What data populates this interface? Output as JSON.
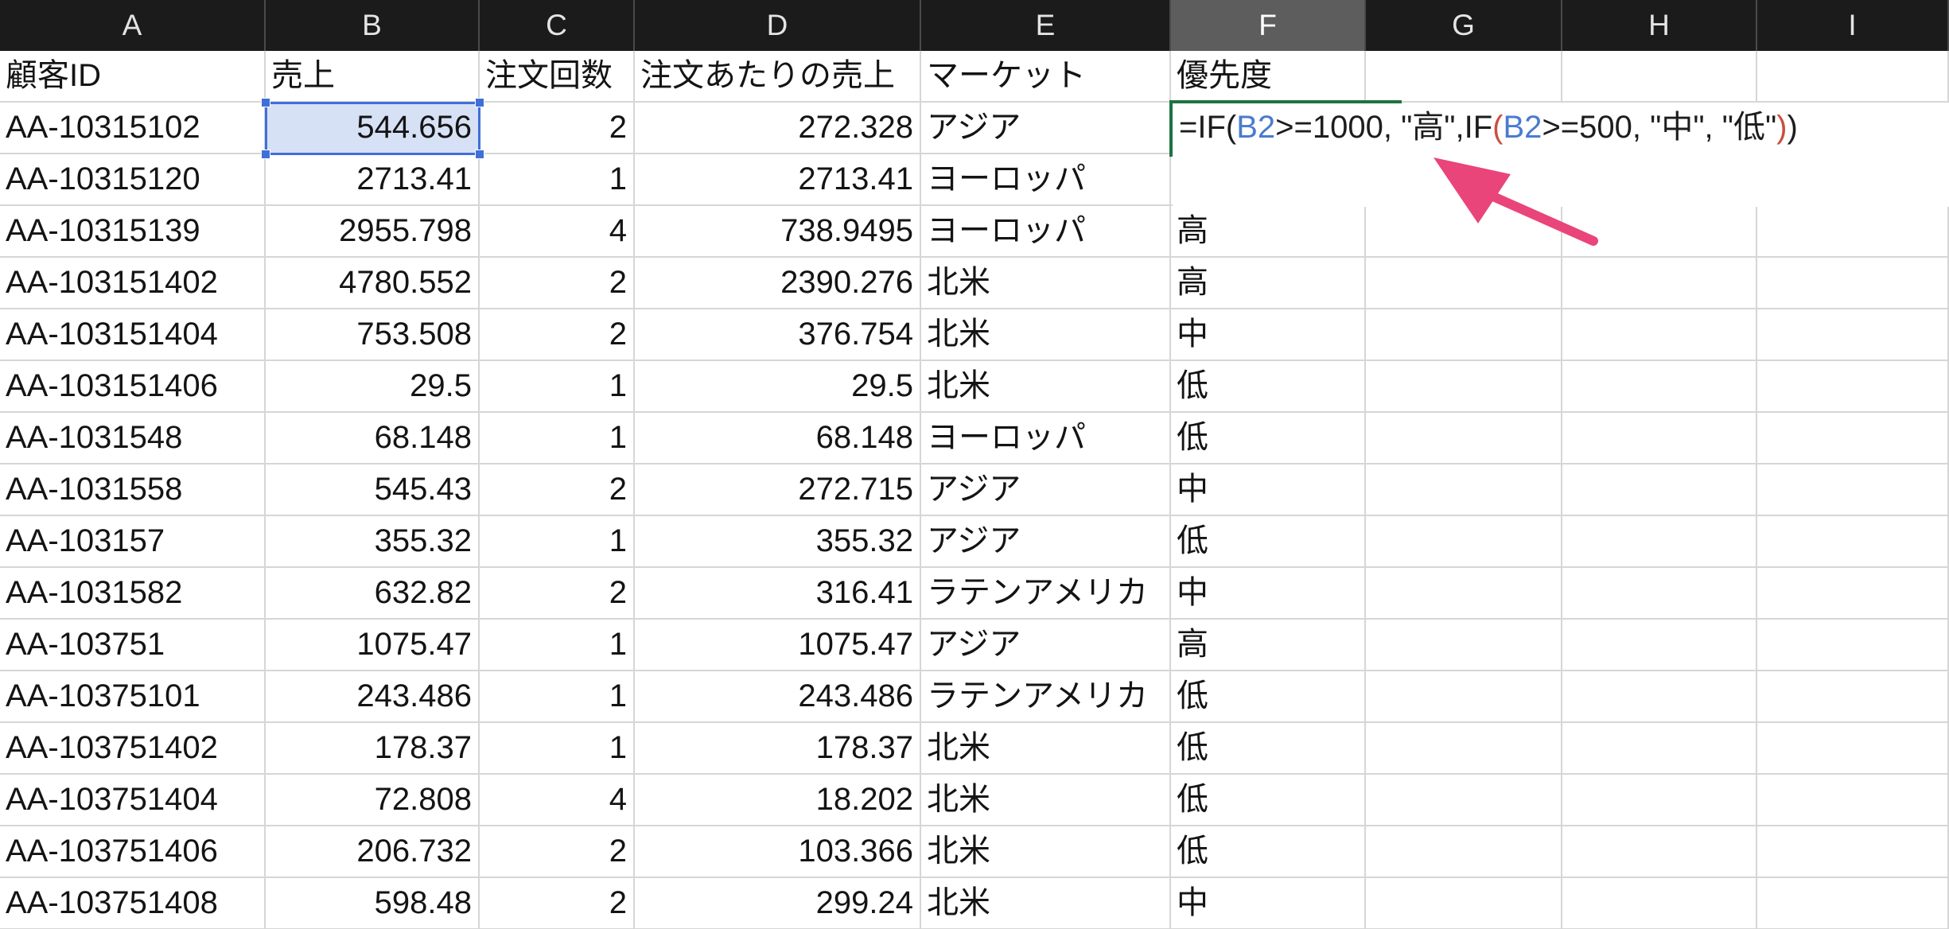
{
  "sheet": {
    "column_headers": [
      "A",
      "B",
      "C",
      "D",
      "E",
      "F",
      "G",
      "H",
      "I"
    ],
    "rows": [
      [
        "顧客ID",
        "売上",
        "注文回数",
        "注文あたりの売上",
        "マーケット",
        "優先度"
      ],
      [
        "AA-10315102",
        "544.656",
        "2",
        "272.328",
        "アジア",
        ""
      ],
      [
        "AA-10315120",
        "2713.41",
        "1",
        "2713.41",
        "ヨーロッパ",
        ""
      ],
      [
        "AA-10315139",
        "2955.798",
        "4",
        "738.9495",
        "ヨーロッパ",
        "高"
      ],
      [
        "AA-103151402",
        "4780.552",
        "2",
        "2390.276",
        "北米",
        "高"
      ],
      [
        "AA-103151404",
        "753.508",
        "2",
        "376.754",
        "北米",
        "中"
      ],
      [
        "AA-103151406",
        "29.5",
        "1",
        "29.5",
        "北米",
        "低"
      ],
      [
        "AA-1031548",
        "68.148",
        "1",
        "68.148",
        "ヨーロッパ",
        "低"
      ],
      [
        "AA-1031558",
        "545.43",
        "2",
        "272.715",
        "アジア",
        "中"
      ],
      [
        "AA-103157",
        "355.32",
        "1",
        "355.32",
        "アジア",
        "低"
      ],
      [
        "AA-1031582",
        "632.82",
        "2",
        "316.41",
        "ラテンアメリカ",
        "中"
      ],
      [
        "AA-103751",
        "1075.47",
        "1",
        "1075.47",
        "アジア",
        "高"
      ],
      [
        "AA-10375101",
        "243.486",
        "1",
        "243.486",
        "ラテンアメリカ",
        "低"
      ],
      [
        "AA-103751402",
        "178.37",
        "1",
        "178.37",
        "北米",
        "低"
      ],
      [
        "AA-103751404",
        "72.808",
        "4",
        "18.202",
        "北米",
        "低"
      ],
      [
        "AA-103751406",
        "206.732",
        "2",
        "103.366",
        "北米",
        "低"
      ],
      [
        "AA-103751408",
        "598.48",
        "2",
        "299.24",
        "北米",
        "中"
      ]
    ]
  },
  "formula_edit": {
    "tokens": [
      {
        "text": "=IF(",
        "color": "#1d1d1d"
      },
      {
        "text": "B2",
        "color": "#4a7bd0"
      },
      {
        "text": ">=1000, \"高\",IF",
        "color": "#1d1d1d"
      },
      {
        "text": "(",
        "color": "#c9503e"
      },
      {
        "text": "B2",
        "color": "#4a7bd0"
      },
      {
        "text": ">=500, \"中\", \"低\"",
        "color": "#1d1d1d"
      },
      {
        "text": ")",
        "color": "#c9503e"
      },
      {
        "text": ")",
        "color": "#1d1d1d"
      }
    ]
  },
  "colors": {
    "selection_fill": "#d7e1f5",
    "selection_border": "#3f6fd8",
    "active_cell_border": "#1f7244",
    "annotation_arrow": "#e9457a"
  }
}
